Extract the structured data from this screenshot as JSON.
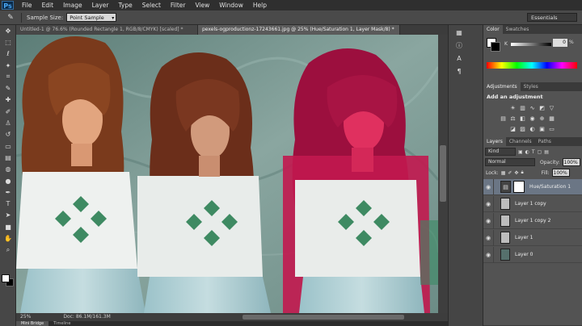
{
  "app": {
    "logo": "Ps"
  },
  "menu": [
    "File",
    "Edit",
    "Image",
    "Layer",
    "Type",
    "Select",
    "Filter",
    "View",
    "Window",
    "Help"
  ],
  "options": {
    "sample_size_label": "Sample Size:",
    "sample_size_value": "Point Sample",
    "workspace": "Essentials"
  },
  "tabs": [
    {
      "label": "Untitled-1 @ 76.6% (Rounded Rectangle 1, RGB/8/CMYK) [scaled] *",
      "active": false
    },
    {
      "label": "pexels-ogproductionz-17243661.jpg @ 25% (Hue/Saturation 1, Layer Mask/8) *",
      "active": true
    }
  ],
  "status": {
    "zoom": "25%",
    "doc": "Doc: 86.1M/161.3M"
  },
  "bottom_tabs": [
    "Mini Bridge",
    "Timeline"
  ],
  "panels": {
    "color_tabs": [
      "Color",
      "Swatches"
    ],
    "k_label": "K",
    "k_value": "0",
    "k_unit": "%",
    "adj_tabs": [
      "Adjustments",
      "Styles"
    ],
    "adj_title": "Add an adjustment",
    "layer_tabs": [
      "Layers",
      "Channels",
      "Paths"
    ],
    "kind": "Kind",
    "blend_mode": "Normal",
    "opacity_label": "Opacity:",
    "opacity_value": "100%",
    "lock_label": "Lock:",
    "fill_label": "Fill:",
    "fill_value": "100%"
  },
  "layers": [
    {
      "name": "Hue/Saturation 1",
      "type": "adjustment",
      "selected": true
    },
    {
      "name": "Layer 1 copy",
      "type": "pixel",
      "selected": false
    },
    {
      "name": "Layer 1 copy 2",
      "type": "pixel",
      "selected": false
    },
    {
      "name": "Layer 1",
      "type": "pixel",
      "selected": false
    },
    {
      "name": "Layer 0",
      "type": "pixel",
      "selected": false
    }
  ],
  "icons": {
    "tools": [
      "move-icon",
      "marquee-icon",
      "lasso-icon",
      "quick-select-icon",
      "crop-icon",
      "eyedropper-icon",
      "healing-icon",
      "brush-icon",
      "clone-stamp-icon",
      "history-brush-icon",
      "eraser-icon",
      "gradient-icon",
      "blur-icon",
      "dodge-icon",
      "pen-icon",
      "type-icon",
      "path-select-icon",
      "shape-icon",
      "hand-icon",
      "zoom-icon"
    ]
  },
  "colors": {
    "canvas_wall": "#6f8f89",
    "accent_selected_layer": "#6b7685"
  }
}
